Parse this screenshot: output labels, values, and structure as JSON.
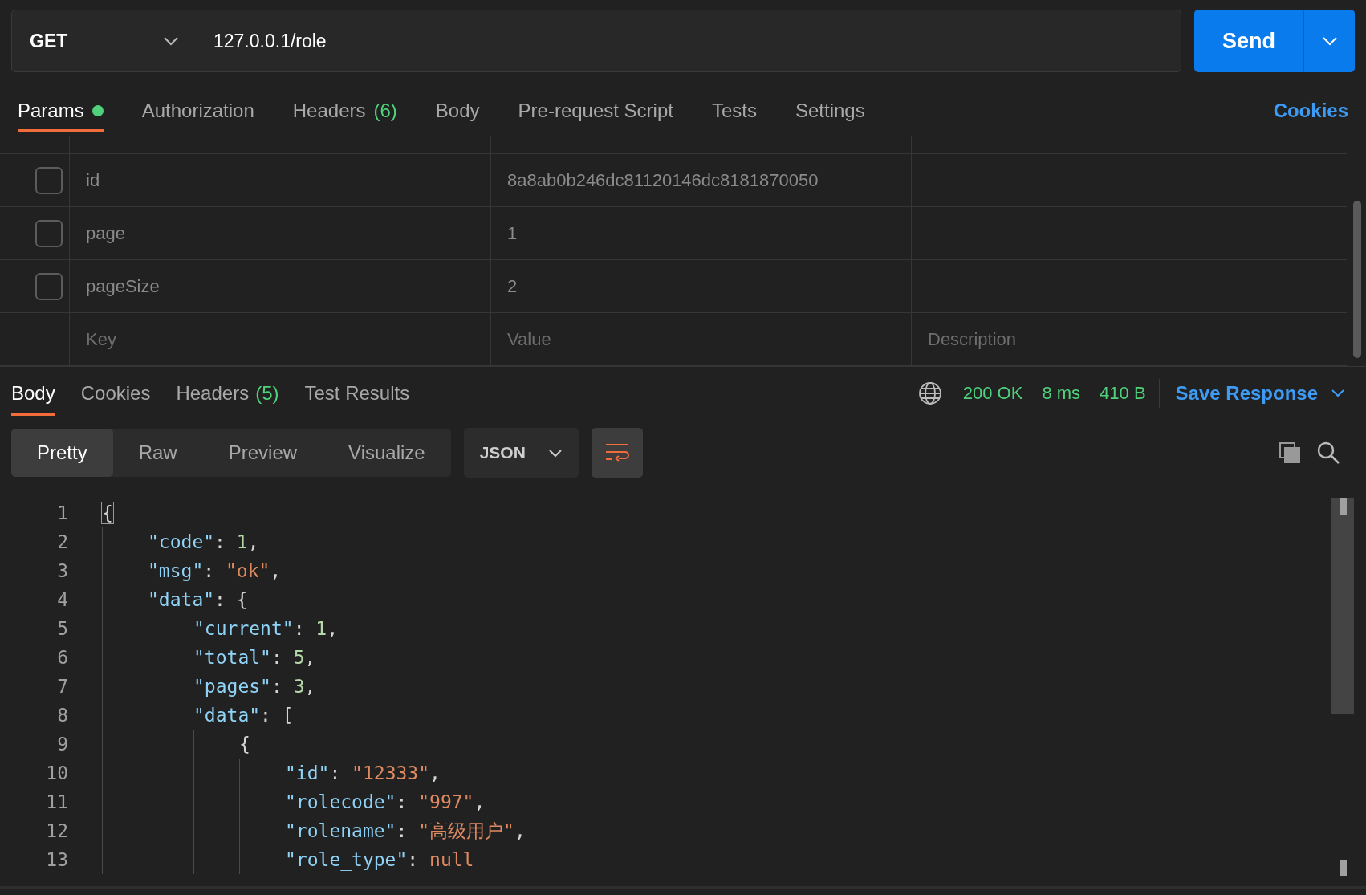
{
  "request": {
    "method": "GET",
    "url": "127.0.0.1/role",
    "send_label": "Send"
  },
  "request_tabs": [
    {
      "label": "Params",
      "indicator": true,
      "selected": true
    },
    {
      "label": "Authorization",
      "indicator": false,
      "selected": false
    },
    {
      "label": "Headers",
      "count": "(6)",
      "indicator": false,
      "selected": false
    },
    {
      "label": "Body",
      "indicator": false,
      "selected": false
    },
    {
      "label": "Pre-request Script",
      "indicator": false,
      "selected": false
    },
    {
      "label": "Tests",
      "indicator": false,
      "selected": false
    },
    {
      "label": "Settings",
      "indicator": false,
      "selected": false
    }
  ],
  "cookies_link": "Cookies",
  "params": [
    {
      "checked": false,
      "key": "id",
      "value": "8a8ab0b246dc81120146dc8181870050"
    },
    {
      "checked": false,
      "key": "page",
      "value": "1"
    },
    {
      "checked": false,
      "key": "pageSize",
      "value": "2"
    }
  ],
  "params_new_row": {
    "key_placeholder": "Key",
    "value_placeholder": "Value",
    "description_placeholder": "Description"
  },
  "response_tabs": [
    {
      "label": "Body",
      "selected": true
    },
    {
      "label": "Cookies",
      "selected": false
    },
    {
      "label": "Headers",
      "count": "(5)",
      "selected": false
    },
    {
      "label": "Test Results",
      "selected": false
    }
  ],
  "response_meta": {
    "status": "200 OK",
    "time": "8 ms",
    "size": "410 B",
    "save_label": "Save Response"
  },
  "view_modes": [
    {
      "label": "Pretty",
      "selected": true
    },
    {
      "label": "Raw",
      "selected": false
    },
    {
      "label": "Preview",
      "selected": false
    },
    {
      "label": "Visualize",
      "selected": false
    }
  ],
  "format": "JSON",
  "wrap_lines": true,
  "code": [
    {
      "number": "1",
      "tokens": [
        {
          "kind": "punct",
          "text": "{",
          "highlighted": true
        }
      ],
      "children": [
        {
          "number": "2",
          "tokens": [
            {
              "kind": "key",
              "text": "\"code\""
            },
            {
              "kind": "punct",
              "text": ": "
            },
            {
              "kind": "number",
              "text": "1"
            },
            {
              "kind": "punct",
              "text": ","
            }
          ]
        },
        {
          "number": "3",
          "tokens": [
            {
              "kind": "key",
              "text": "\"msg\""
            },
            {
              "kind": "punct",
              "text": ": "
            },
            {
              "kind": "string",
              "text": "\"ok\""
            },
            {
              "kind": "punct",
              "text": ","
            }
          ]
        },
        {
          "number": "4",
          "tokens": [
            {
              "kind": "key",
              "text": "\"data\""
            },
            {
              "kind": "punct",
              "text": ": {"
            }
          ],
          "children": [
            {
              "number": "5",
              "tokens": [
                {
                  "kind": "key",
                  "text": "\"current\""
                },
                {
                  "kind": "punct",
                  "text": ": "
                },
                {
                  "kind": "number",
                  "text": "1"
                },
                {
                  "kind": "punct",
                  "text": ","
                }
              ]
            },
            {
              "number": "6",
              "tokens": [
                {
                  "kind": "key",
                  "text": "\"total\""
                },
                {
                  "kind": "punct",
                  "text": ": "
                },
                {
                  "kind": "number",
                  "text": "5"
                },
                {
                  "kind": "punct",
                  "text": ","
                }
              ]
            },
            {
              "number": "7",
              "tokens": [
                {
                  "kind": "key",
                  "text": "\"pages\""
                },
                {
                  "kind": "punct",
                  "text": ": "
                },
                {
                  "kind": "number",
                  "text": "3"
                },
                {
                  "kind": "punct",
                  "text": ","
                }
              ]
            },
            {
              "number": "8",
              "tokens": [
                {
                  "kind": "key",
                  "text": "\"data\""
                },
                {
                  "kind": "punct",
                  "text": ": ["
                }
              ],
              "children": [
                {
                  "number": "9",
                  "tokens": [
                    {
                      "kind": "punct",
                      "text": "{"
                    }
                  ],
                  "children": [
                    {
                      "number": "10",
                      "tokens": [
                        {
                          "kind": "key",
                          "text": "\"id\""
                        },
                        {
                          "kind": "punct",
                          "text": ": "
                        },
                        {
                          "kind": "string",
                          "text": "\"12333\""
                        },
                        {
                          "kind": "punct",
                          "text": ","
                        }
                      ]
                    },
                    {
                      "number": "11",
                      "tokens": [
                        {
                          "kind": "key",
                          "text": "\"rolecode\""
                        },
                        {
                          "kind": "punct",
                          "text": ": "
                        },
                        {
                          "kind": "string",
                          "text": "\"997\""
                        },
                        {
                          "kind": "punct",
                          "text": ","
                        }
                      ]
                    },
                    {
                      "number": "12",
                      "tokens": [
                        {
                          "kind": "key",
                          "text": "\"rolename\""
                        },
                        {
                          "kind": "punct",
                          "text": ": "
                        },
                        {
                          "kind": "string",
                          "text": "\"高级用户\""
                        },
                        {
                          "kind": "punct",
                          "text": ","
                        }
                      ]
                    },
                    {
                      "number": "13",
                      "tokens": [
                        {
                          "kind": "key",
                          "text": "\"role_type\""
                        },
                        {
                          "kind": "punct",
                          "text": ": "
                        },
                        {
                          "kind": "null",
                          "text": "null"
                        }
                      ]
                    }
                  ]
                }
              ]
            }
          ]
        }
      ]
    }
  ]
}
